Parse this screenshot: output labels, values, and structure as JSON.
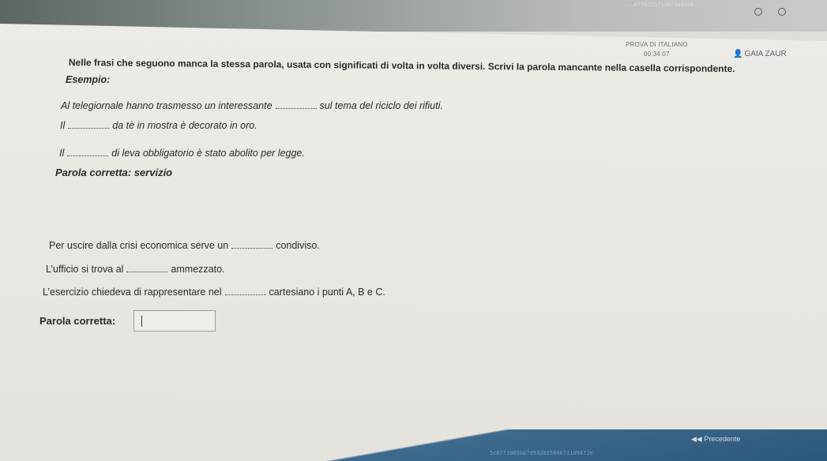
{
  "browser": {
    "url_fragment": "...ef7e25b7139c9a4a8b..."
  },
  "header": {
    "test_name": "PROVA DI ITALIANO",
    "timer": "00:34:07",
    "user_name": "GAIA ZAUR"
  },
  "question": {
    "instruction": "Nelle frasi che seguono manca la stessa parola, usata con significati di volta in volta diversi. Scrivi la parola mancante nella casella corrispondente.",
    "example_label": "Esempio:",
    "example_lines": [
      {
        "before": "Al telegiornale hanno trasmesso un interessante",
        "after": "sul tema del riciclo dei rifiuti."
      },
      {
        "before": "Il",
        "after": "da tè in mostra è decorato in oro."
      },
      {
        "before": "Il",
        "after": "di leva obbligatorio è stato abolito per legge."
      }
    ],
    "example_answer": "Parola corretta: servizio",
    "exercise_lines": [
      {
        "before": "Per uscire dalla crisi economica serve un",
        "after": "condiviso."
      },
      {
        "before": "L’ufficio si trova al",
        "after": "ammezzato."
      },
      {
        "before": "L’esercizio chiedeva di rappresentare nel",
        "after": "cartesiano i punti A, B e C."
      }
    ],
    "answer_label": "Parola corretta:",
    "answer_value": ""
  },
  "footer": {
    "prev_label": "Precedente",
    "session_id": "5c67f1965bb7d93202504071109472e"
  }
}
